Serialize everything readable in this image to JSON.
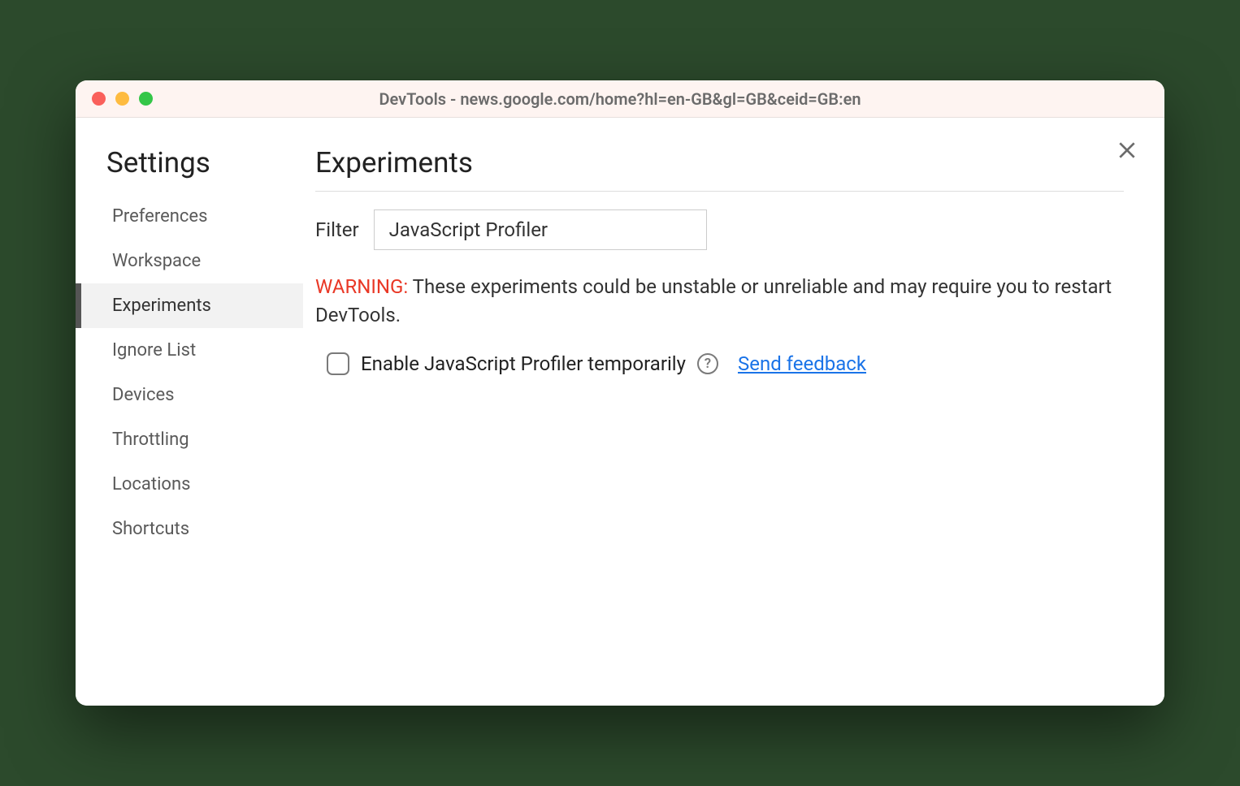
{
  "window": {
    "title": "DevTools - news.google.com/home?hl=en-GB&gl=GB&ceid=GB:en"
  },
  "sidebar": {
    "title": "Settings",
    "items": [
      {
        "label": "Preferences"
      },
      {
        "label": "Workspace"
      },
      {
        "label": "Experiments"
      },
      {
        "label": "Ignore List"
      },
      {
        "label": "Devices"
      },
      {
        "label": "Throttling"
      },
      {
        "label": "Locations"
      },
      {
        "label": "Shortcuts"
      }
    ],
    "active_index": 2
  },
  "main": {
    "heading": "Experiments",
    "filter": {
      "label": "Filter",
      "value": "JavaScript Profiler"
    },
    "warning": {
      "prefix": "WARNING:",
      "text": " These experiments could be unstable or unreliable and may require you to restart DevTools."
    },
    "experiment": {
      "label": "Enable JavaScript Profiler temporarily",
      "checked": false,
      "help_glyph": "?",
      "feedback_label": "Send feedback"
    }
  }
}
